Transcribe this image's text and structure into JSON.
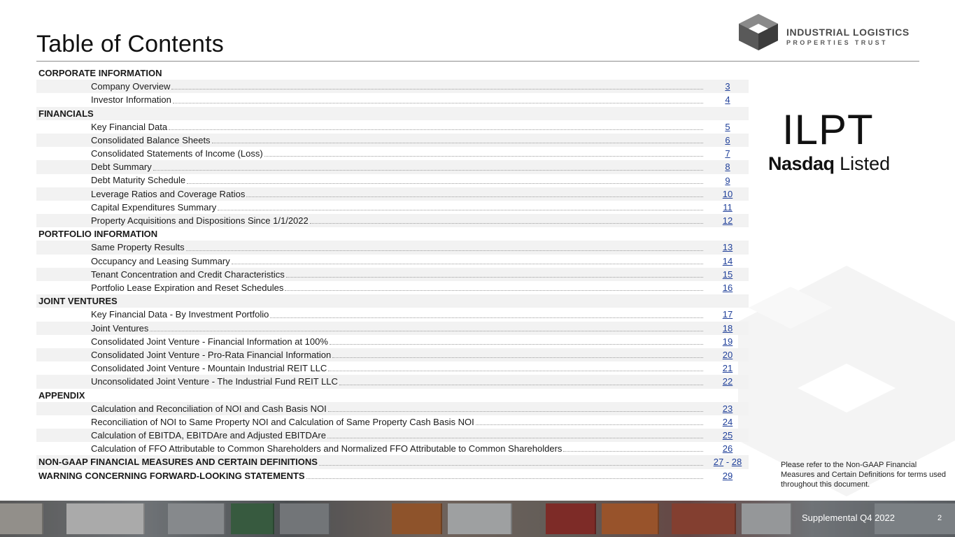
{
  "header": {
    "title": "Table of Contents",
    "logo_line1": "INDUSTRIAL LOGISTICS",
    "logo_line2": "PROPERTIES TRUST"
  },
  "listing": {
    "ticker": "ILPT",
    "exchange_bold": "Nasdaq",
    "exchange_light": "Listed"
  },
  "toc": [
    {
      "kind": "section",
      "label": "CORPORATE INFORMATION"
    },
    {
      "kind": "entry",
      "label": "Company Overview",
      "page": "3"
    },
    {
      "kind": "entry",
      "label": "Investor Information",
      "page": "4"
    },
    {
      "kind": "section",
      "label": "FINANCIALS"
    },
    {
      "kind": "entry",
      "label": "Key Financial Data",
      "page": "5"
    },
    {
      "kind": "entry",
      "label": "Consolidated Balance Sheets",
      "page": "6"
    },
    {
      "kind": "entry",
      "label": "Consolidated Statements of Income (Loss)",
      "page": "7"
    },
    {
      "kind": "entry",
      "label": "Debt Summary",
      "page": "8"
    },
    {
      "kind": "entry",
      "label": "Debt Maturity Schedule",
      "page": "9"
    },
    {
      "kind": "entry",
      "label": "Leverage Ratios and Coverage Ratios",
      "page": "10"
    },
    {
      "kind": "entry",
      "label": "Capital Expenditures Summary",
      "page": "11"
    },
    {
      "kind": "entry",
      "label": "Property Acquisitions and Dispositions Since 1/1/2022",
      "page": "12"
    },
    {
      "kind": "section",
      "label": "PORTFOLIO INFORMATION"
    },
    {
      "kind": "entry",
      "label": "Same Property Results",
      "page": "13"
    },
    {
      "kind": "entry",
      "label": "Occupancy and Leasing Summary",
      "page": "14"
    },
    {
      "kind": "entry",
      "label": "Tenant Concentration and Credit Characteristics",
      "page": "15"
    },
    {
      "kind": "entry",
      "label": "Portfolio Lease Expiration and Reset Schedules",
      "page": "16"
    },
    {
      "kind": "section",
      "label": "JOINT VENTURES"
    },
    {
      "kind": "entry",
      "label": "Key Financial Data - By Investment Portfolio",
      "page": "17"
    },
    {
      "kind": "entry",
      "label": "Joint Ventures",
      "page": "18"
    },
    {
      "kind": "entry",
      "label": "Consolidated Joint Venture - Financial Information at 100%",
      "page": "19"
    },
    {
      "kind": "entry",
      "label": "Consolidated Joint Venture - Pro-Rata Financial Information",
      "page": "20"
    },
    {
      "kind": "entry",
      "label": "Consolidated Joint Venture - Mountain Industrial REIT LLC",
      "page": "21"
    },
    {
      "kind": "entry",
      "label": "Unconsolidated Joint Venture - The Industrial Fund REIT LLC",
      "page": "22"
    },
    {
      "kind": "section",
      "label": "APPENDIX"
    },
    {
      "kind": "entry",
      "label": "Calculation and Reconciliation of NOI and Cash Basis NOI",
      "page": "23"
    },
    {
      "kind": "entry",
      "label": "Reconciliation of NOI to Same Property NOI and Calculation of Same Property Cash Basis NOI",
      "page": "24"
    },
    {
      "kind": "entry",
      "label": "Calculation of EBITDA, EBITDAre and Adjusted EBITDAre",
      "page": "25"
    },
    {
      "kind": "entry",
      "label": "Calculation of FFO Attributable to Common Shareholders and Normalized FFO Attributable to Common Shareholders",
      "page": "26"
    },
    {
      "kind": "bold-entry",
      "label": "NON-GAAP FINANCIAL MEASURES AND CERTAIN DEFINITIONS",
      "page": "27",
      "page_end": "28",
      "range_sep": "-"
    },
    {
      "kind": "bold-entry",
      "label": "WARNING CONCERNING FORWARD-LOOKING STATEMENTS",
      "page": "29"
    }
  ],
  "side_note": "Please refer to the Non-GAAP Financial Measures and Certain Definitions for terms used throughout this document.",
  "footer": {
    "label": "Supplemental Q4 2022",
    "page_number": "2"
  }
}
